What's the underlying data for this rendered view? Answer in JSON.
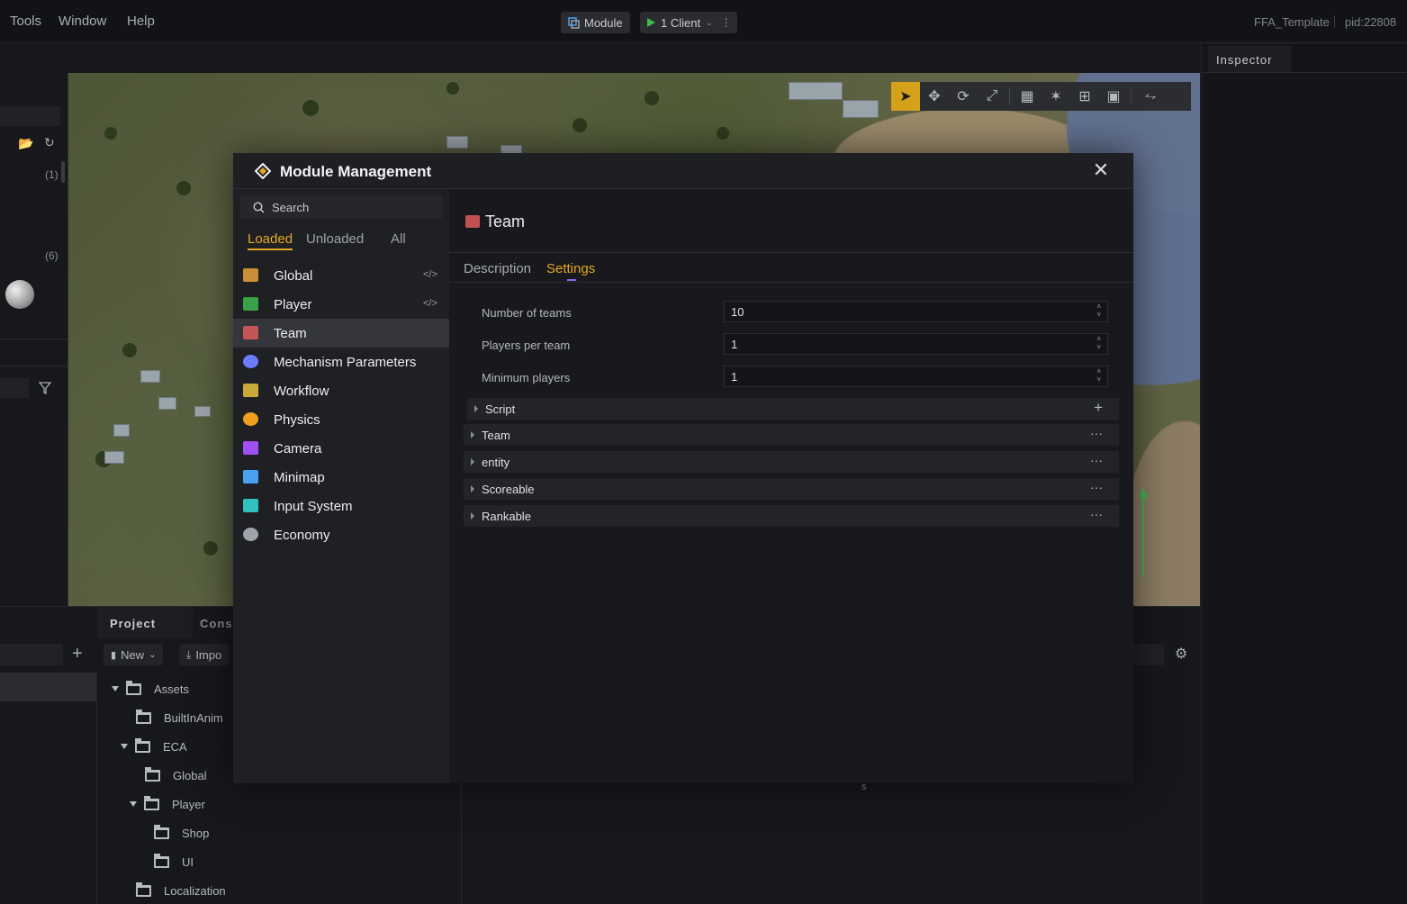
{
  "menu": {
    "tools": "Tools",
    "window": "Window",
    "help": "Help"
  },
  "topbar": {
    "module_label": "Module",
    "client_label": "1 Client",
    "project_name": "FFA_Template",
    "pid": "pid:22808"
  },
  "inspector": {
    "title": "Inspector"
  },
  "left_panel": {
    "count1": "(1)",
    "count2": "(6)"
  },
  "bottom": {
    "tabs": [
      "Project",
      "Conso"
    ],
    "new_label": "New",
    "import_label": "Impo",
    "status_char": "s"
  },
  "tree": {
    "items": [
      {
        "label": "Assets"
      },
      {
        "label": "BuiltInAnim"
      },
      {
        "label": "ECA"
      },
      {
        "label": "Global"
      },
      {
        "label": "Player"
      },
      {
        "label": "Shop"
      },
      {
        "label": "UI"
      },
      {
        "label": "Localization"
      }
    ]
  },
  "modal": {
    "title": "Module Management",
    "search_placeholder": "Search",
    "filter_tabs": [
      "Loaded",
      "Unloaded",
      "All"
    ],
    "active_filter": "Loaded",
    "modules": [
      {
        "label": "Global",
        "icon": "global-module-icon",
        "color": "#e8a33c",
        "code": "</>"
      },
      {
        "label": "Player",
        "icon": "player-module-icon",
        "color": "#3fb950",
        "code": "</>"
      },
      {
        "label": "Team",
        "icon": "team-module-icon",
        "color": "#e05a5a",
        "code": ""
      },
      {
        "label": "Mechanism Parameters",
        "icon": "mechanism-module-icon",
        "color": "#6b7cff",
        "code": ""
      },
      {
        "label": "Workflow",
        "icon": "workflow-module-icon",
        "color": "#e8c23c",
        "code": ""
      },
      {
        "label": "Physics",
        "icon": "physics-module-icon",
        "color": "#f0a020",
        "code": ""
      },
      {
        "label": "Camera",
        "icon": "camera-module-icon",
        "color": "#a050f0",
        "code": ""
      },
      {
        "label": "Minimap",
        "icon": "minimap-module-icon",
        "color": "#4aa0f0",
        "code": ""
      },
      {
        "label": "Input System",
        "icon": "input-system-module-icon",
        "color": "#30c0c0",
        "code": ""
      },
      {
        "label": "Economy",
        "icon": "economy-module-icon",
        "color": "#a0a4aa",
        "code": ""
      }
    ],
    "selected_module": "Team",
    "content": {
      "title": "Team",
      "tabs": [
        "Description",
        "Settings"
      ],
      "active_tab": "Settings",
      "fields": [
        {
          "label": "Number of teams",
          "value": "10"
        },
        {
          "label": "Players per team",
          "value": "1"
        },
        {
          "label": "Minimum players",
          "value": "1"
        }
      ],
      "sections": [
        {
          "label": "Script",
          "action": "+"
        },
        {
          "label": "Team",
          "action": "···"
        },
        {
          "label": "entity",
          "action": "···"
        },
        {
          "label": "Scoreable",
          "action": "···"
        },
        {
          "label": "Rankable",
          "action": "···"
        }
      ]
    }
  },
  "colors": {
    "accent": "#e5a822",
    "tab_indicator": "#8e6cf0",
    "active_tool": "#d6a11b"
  }
}
